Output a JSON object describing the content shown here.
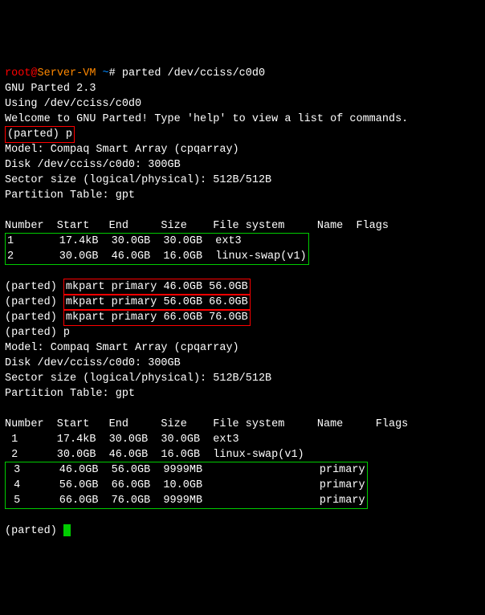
{
  "prompt": {
    "user": "root",
    "at": "@",
    "host": "Server-VM",
    "tilde": " ~",
    "hash": "# ",
    "cmd": "parted /dev/cciss/c0d0"
  },
  "intro": {
    "l1": "GNU Parted 2.3",
    "l2": "Using /dev/cciss/c0d0",
    "l3": "Welcome to GNU Parted! Type 'help' to view a list of commands."
  },
  "p1": {
    "prompt": "(parted) ",
    "cmd": "p"
  },
  "info": {
    "model": "Model: Compaq Smart Array (cpqarray)",
    "disk": "Disk /dev/cciss/c0d0: 300GB",
    "sector": "Sector size (logical/physical): 512B/512B",
    "ptable": "Partition Table: gpt"
  },
  "header": "Number  Start   End     Size    File system     Name  Flags",
  "t1": {
    "r1": "1       17.4kB  30.0GB  30.0GB  ext3",
    "r2": "2       30.0GB  46.0GB  16.0GB  linux-swap(v1)"
  },
  "mk": {
    "prompt": "(parted) ",
    "c1": "mkpart primary 46.0GB 56.0GB",
    "c2": "mkpart primary 56.0GB 66.0GB",
    "c3": "mkpart primary 66.0GB 76.0GB"
  },
  "p2": {
    "prompt": "(parted) ",
    "cmd": "p"
  },
  "header2": "Number  Start   End     Size    File system     Name     Flags",
  "t2": {
    "r1": " 1      17.4kB  30.0GB  30.0GB  ext3",
    "r2": " 2      30.0GB  46.0GB  16.0GB  linux-swap(v1)",
    "r3": " 3      46.0GB  56.0GB  9999MB                  primary",
    "r4": " 4      56.0GB  66.0GB  10.0GB                  primary",
    "r5": " 5      66.0GB  76.0GB  9999MB                  primary"
  },
  "final": {
    "prompt": "(parted) "
  }
}
